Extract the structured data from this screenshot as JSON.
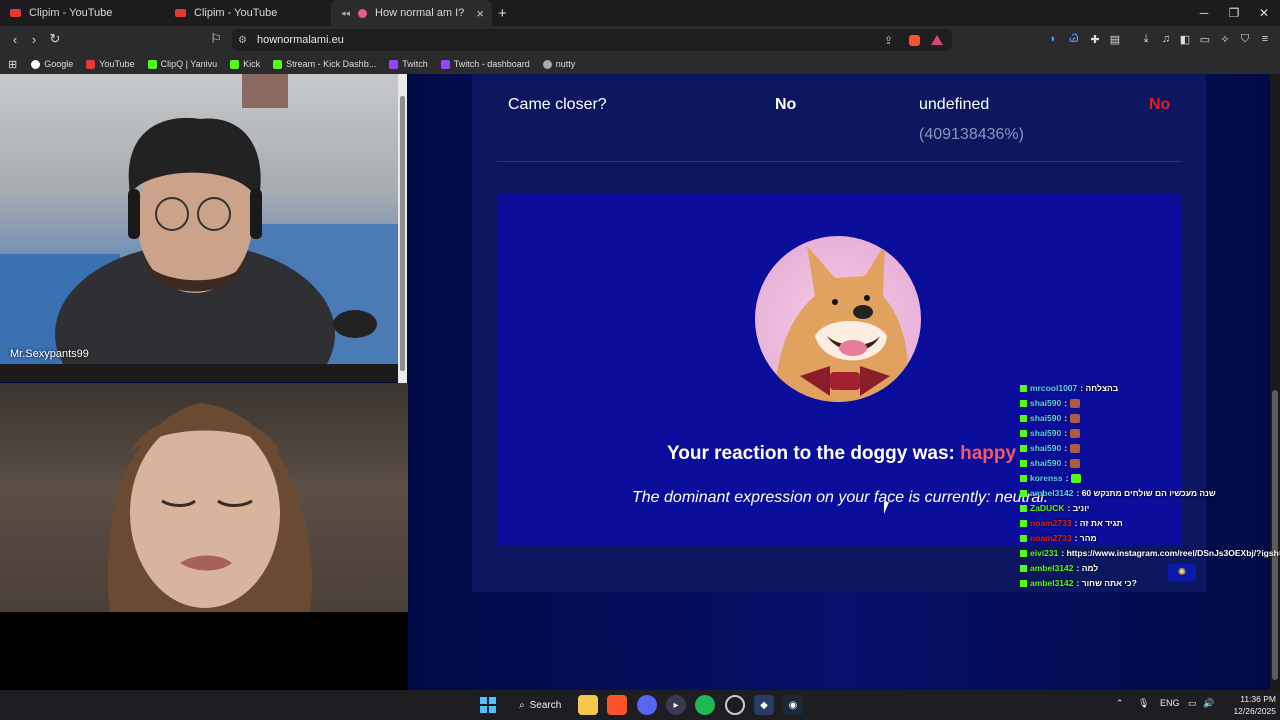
{
  "browser": {
    "tabs": [
      {
        "label": "Clipim - YouTube",
        "active": false
      },
      {
        "label": "Clipim - YouTube",
        "active": false
      },
      {
        "label": "How normal am I?",
        "active": true
      }
    ],
    "new_tab": "+",
    "url": "hownormalami.eu",
    "bookmarks": [
      "Google",
      "YouTube",
      "ClipQ | Yanivu",
      "Kick",
      "Stream - Kick Dashb...",
      "Twitch",
      "Twitch - dashboard",
      "nutty"
    ]
  },
  "stream": {
    "streamer_name": "Mr.Sexypants99"
  },
  "page": {
    "row": {
      "question": "Came closer?",
      "answer": "No",
      "avg_value": "undefined",
      "avg_percent": "(409138436%)",
      "verdict": "No"
    },
    "reaction_prefix": "Your reaction to the doggy was:",
    "reaction_value": "happy",
    "dominant_text": "The dominant expression on your face is currently: neutral."
  },
  "chat": [
    {
      "user": "mrcool1007",
      "msg": ": בהצלחה"
    },
    {
      "user": "shai590",
      "msg": ":",
      "emote": true
    },
    {
      "user": "shai590",
      "msg": ":",
      "emote": true
    },
    {
      "user": "shai590",
      "msg": ":",
      "emote": true
    },
    {
      "user": "shai590",
      "msg": ":",
      "emote": true
    },
    {
      "user": "shai590",
      "msg": ":",
      "emote": true
    },
    {
      "user": "korenss",
      "msg": ":"
    },
    {
      "user": "ambel3142",
      "msg": ": שנה מעכשיו הם שולחים מתנקש 60"
    },
    {
      "user": "ZaDUCK",
      "msg": ": יוניב"
    },
    {
      "user": "noam2733",
      "msg": ": תגיד את זה"
    },
    {
      "user": "noam2733",
      "msg": ": מהר"
    },
    {
      "user": "eivi231",
      "msg": ": https://www.instagram.com/reel/DSnJs3OEXbj/?igsh=c"
    },
    {
      "user": "ambel3142",
      "msg": ": למה"
    },
    {
      "user": "ambel3142",
      "msg": ": כי אתה שחור?"
    }
  ],
  "taskbar": {
    "search_label": "Search",
    "lang": "ENG",
    "time": "11:36 PM",
    "date": "12/26/2025"
  },
  "colors": {
    "page_bg": "#020a3a",
    "card_bg": "#0c1760",
    "inner_bg": "#0a0e9a",
    "happy": "#f2596a",
    "verdict_no": "#e0201c",
    "kick_green": "#53fc18"
  }
}
